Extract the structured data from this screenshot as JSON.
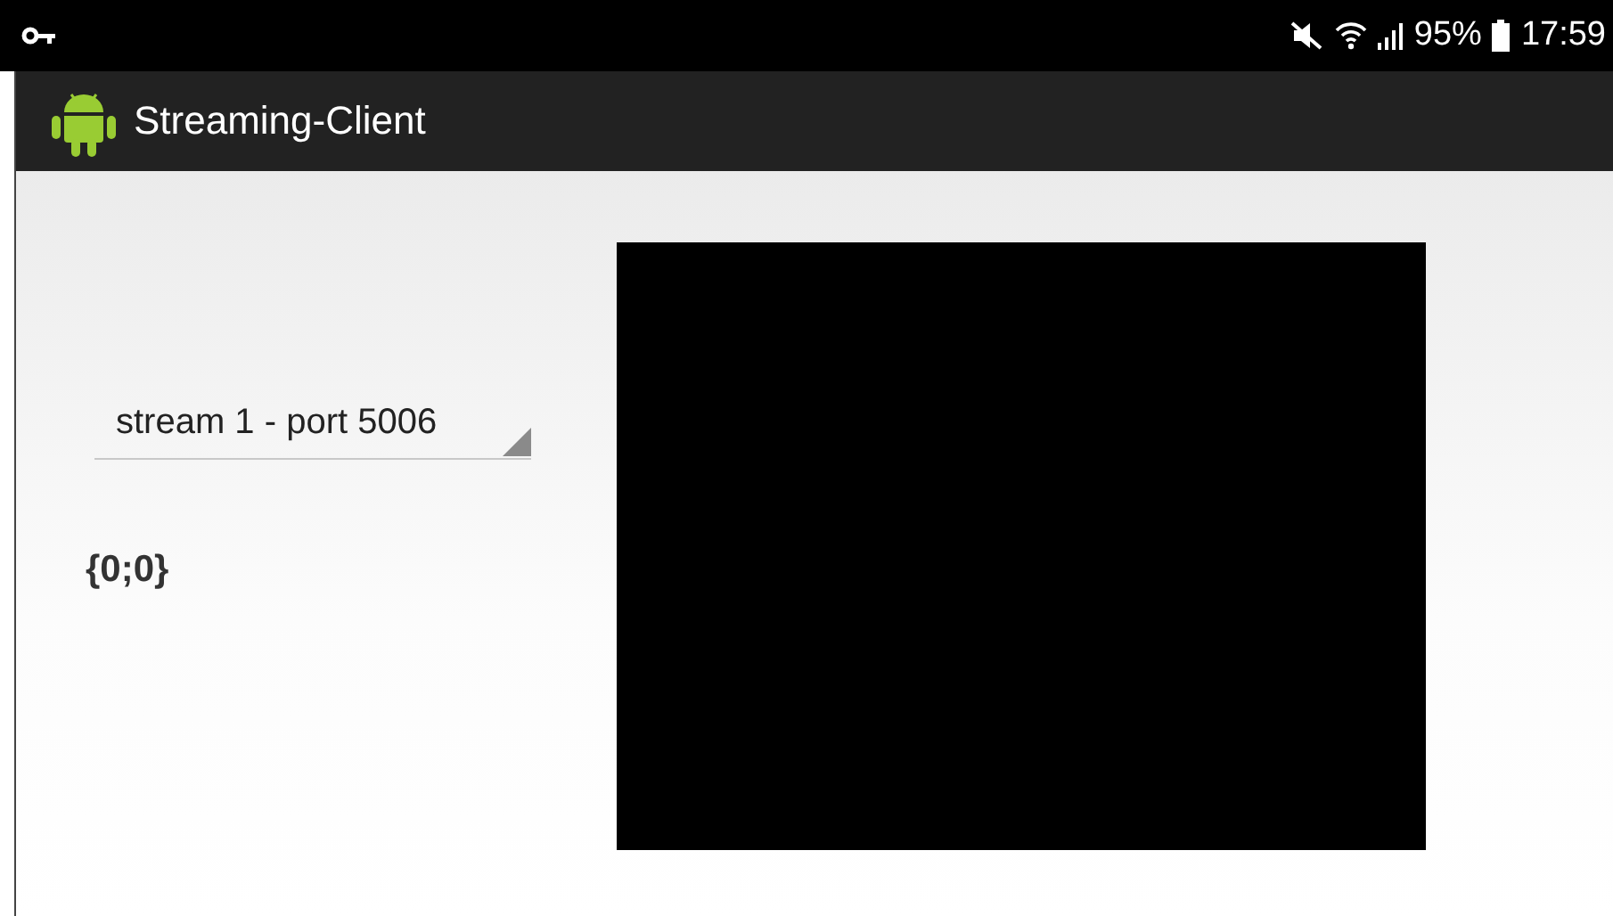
{
  "status_bar": {
    "battery": "95%",
    "time": "17:59"
  },
  "action_bar": {
    "title": "Streaming-Client"
  },
  "stream_spinner": {
    "value": "stream 1 - port 5006"
  },
  "coordinates": "{0;0}",
  "video_view": {
    "kind": "video"
  }
}
